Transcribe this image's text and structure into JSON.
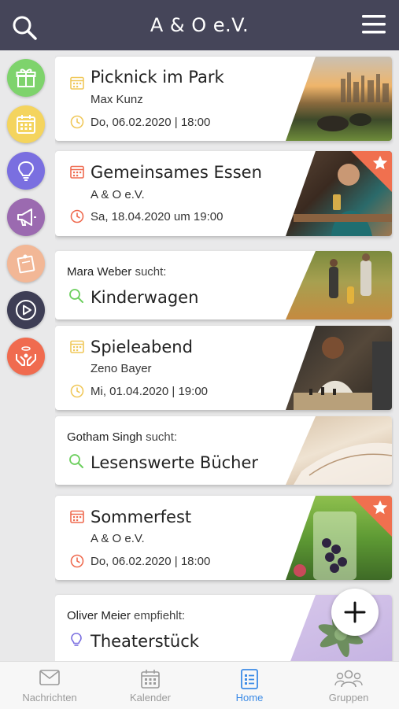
{
  "header": {
    "title": "A & O e.V."
  },
  "sidebar": {
    "categories": [
      {
        "icon": "gift-icon",
        "color": "#7ed36c"
      },
      {
        "icon": "calendar-icon",
        "color": "#f4d45e"
      },
      {
        "icon": "lightbulb-icon",
        "color": "#7a6fe0"
      },
      {
        "icon": "megaphone-icon",
        "color": "#9b6ab0"
      },
      {
        "icon": "note-icon",
        "color": "#f2b796"
      },
      {
        "icon": "play-icon",
        "color": "#3e3e55"
      },
      {
        "icon": "helping-hands-icon",
        "color": "#f06b4f"
      }
    ]
  },
  "feed": {
    "cards": [
      {
        "type": "event",
        "title": "Picknick im Park",
        "organizer": "Max Kunz",
        "date": "Do, 06.02.2020 | 18:00",
        "accent": "#f0c85a"
      },
      {
        "type": "event",
        "title": "Gemeinsames Essen",
        "organizer": "A & O e.V.",
        "date": "Sa, 18.04.2020 um 19:00",
        "accent": "#ef6b50",
        "starred": true
      },
      {
        "type": "search",
        "person": "Mara Weber",
        "verb": "sucht:",
        "title": "Kinderwagen",
        "accent": "#6ccf5e"
      },
      {
        "type": "event",
        "title": "Spieleabend",
        "organizer": "Zeno Bayer",
        "date": "Mi, 01.04.2020 | 19:00",
        "accent": "#f0c85a"
      },
      {
        "type": "search",
        "person": "Gotham Singh",
        "verb": "sucht:",
        "title": "Lesenswerte Bücher",
        "accent": "#6ccf5e"
      },
      {
        "type": "event",
        "title": "Sommerfest",
        "organizer": "A & O e.V.",
        "date": "Do, 06.02.2020 | 18:00",
        "accent": "#ef6b50",
        "starred": true
      },
      {
        "type": "recommend",
        "person": "Oliver Meier",
        "verb": "empfiehlt:",
        "title": "Theaterstück",
        "accent": "#7a6fe0"
      }
    ]
  },
  "tabbar": {
    "tabs": [
      {
        "label": "Nachrichten",
        "icon": "mail-icon"
      },
      {
        "label": "Kalender",
        "icon": "calendar-icon"
      },
      {
        "label": "Home",
        "icon": "list-icon",
        "active": true
      },
      {
        "label": "Gruppen",
        "icon": "group-icon"
      }
    ]
  }
}
